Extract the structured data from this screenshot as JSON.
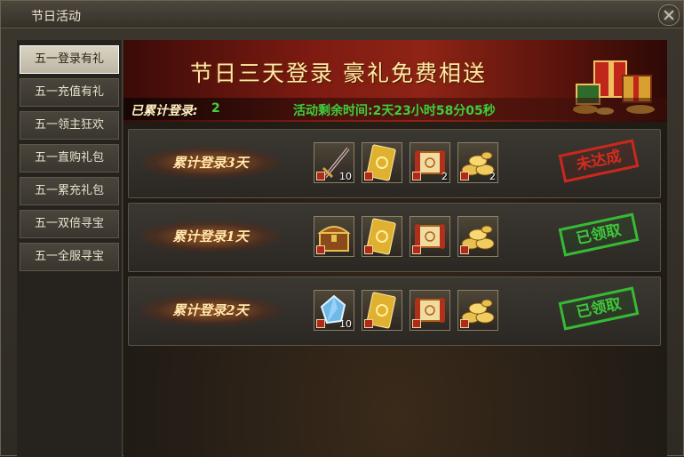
{
  "window": {
    "title": "节日活动"
  },
  "sidebar": {
    "items": [
      {
        "label": "五一登录有礼"
      },
      {
        "label": "五一充值有礼"
      },
      {
        "label": "五一领主狂欢"
      },
      {
        "label": "五一直购礼包"
      },
      {
        "label": "五一累充礼包"
      },
      {
        "label": "五一双倍寻宝"
      },
      {
        "label": "五一全服寻宝"
      }
    ],
    "active_index": 0
  },
  "banner": {
    "title": "节日三天登录  豪礼免费相送",
    "login_label": "已累计登录:",
    "login_count": "2",
    "countdown": "活动剩余时间:2天23小时58分05秒"
  },
  "rewards": [
    {
      "label": "累计登录3天",
      "status": "未达成",
      "items": [
        {
          "icon": "sword-icon",
          "qty": "10"
        },
        {
          "icon": "gold-card-icon",
          "qty": ""
        },
        {
          "icon": "scroll-icon",
          "qty": "2"
        },
        {
          "icon": "gold-ingot-icon",
          "qty": "2"
        }
      ]
    },
    {
      "label": "累计登录1天",
      "status": "已领取",
      "items": [
        {
          "icon": "treasure-chest-icon",
          "qty": ""
        },
        {
          "icon": "gold-card-icon",
          "qty": ""
        },
        {
          "icon": "scroll-icon",
          "qty": ""
        },
        {
          "icon": "gold-ingot-icon",
          "qty": ""
        }
      ]
    },
    {
      "label": "累计登录2天",
      "status": "已领取",
      "items": [
        {
          "icon": "crystal-gem-icon",
          "qty": "10"
        },
        {
          "icon": "gold-card-icon",
          "qty": ""
        },
        {
          "icon": "scroll-icon",
          "qty": ""
        },
        {
          "icon": "gold-ingot-icon",
          "qty": ""
        }
      ]
    }
  ],
  "colors": {
    "status_red": "#d52b1e",
    "status_green": "#3fc63c",
    "countdown_green": "#3ccf3b",
    "banner_red": "#8f2416"
  }
}
